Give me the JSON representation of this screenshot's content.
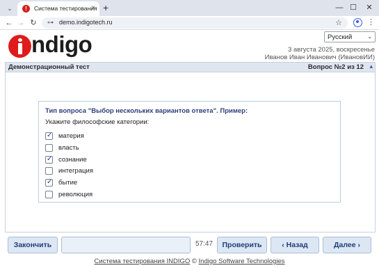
{
  "browser": {
    "tab_title": "Система тестирования",
    "tab_favicon": "!",
    "tab_close": "×",
    "new_tab": "+",
    "tab_menu": "⌄",
    "win_min": "—",
    "win_max": "☐",
    "win_close": "✕",
    "back": "←",
    "forward": "→",
    "reload": "↻",
    "site_info": "⊶",
    "url": "demo.indigotech.ru",
    "bookmark": "☆",
    "more": "⋮"
  },
  "header": {
    "logo_letter": "i",
    "logo_rest": "ndigo",
    "language": "Русский",
    "lang_arrow": "⌄",
    "date": "3 августа 2025, воскресенье",
    "user": "Иванов Иван Иванович (ИвановИИ)"
  },
  "panel": {
    "test_name": "Демонстрационный тест",
    "question_counter": "Вопрос №2 из 12",
    "collapse_icon": "▴"
  },
  "question": {
    "type_title": "Тип вопроса \"Выбор нескольких вариантов ответа\". Пример:",
    "text": "Укажите философские категории:",
    "options": [
      {
        "label": "материя",
        "checked": true
      },
      {
        "label": "власть",
        "checked": false
      },
      {
        "label": "сознание",
        "checked": true
      },
      {
        "label": "интеграция",
        "checked": false
      },
      {
        "label": "бытие",
        "checked": true
      },
      {
        "label": "революция",
        "checked": false
      }
    ]
  },
  "controls": {
    "finish": "Закончить",
    "timer": "57:47",
    "check": "Проверить",
    "back": "‹ Назад",
    "next": "Далее ›"
  },
  "footer": {
    "system": "Система тестирования INDIGO",
    "copyright": "©",
    "company": "Indigo Software Technologies"
  }
}
